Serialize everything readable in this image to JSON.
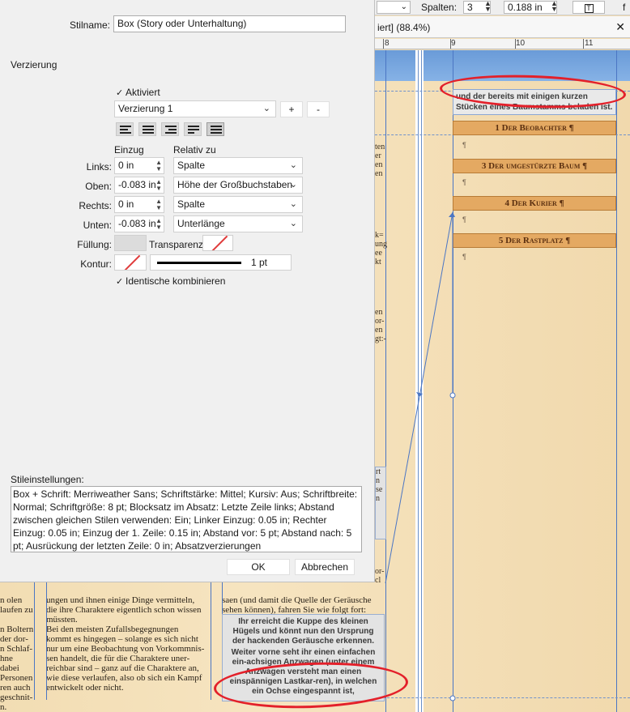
{
  "toolbar": {
    "columns_label": "Spalten:",
    "columns_value": "3",
    "gutter_value": "0.188 in"
  },
  "document": {
    "tab_title": "iert] (88.4%)",
    "ruler_numbers": [
      "8",
      "9",
      "10",
      "11"
    ],
    "top_box_text": "und der bereits mit einigen kurzen Stücken eines Baumstamms beladen ist.",
    "headings": [
      {
        "num": "1",
        "label": "Der Beobachter"
      },
      {
        "num": "3",
        "label": "Der umgestürzte Baum"
      },
      {
        "num": "4",
        "label": "Der Kurier"
      },
      {
        "num": "5",
        "label": "Der Rastplatz"
      }
    ],
    "left_col1": [
      "n olen",
      "laufen zu",
      "",
      "n Boltern",
      "der dor-",
      "n Schlaf-",
      "hne dabei",
      "Personen",
      "ren auch",
      "geschnit-",
      "n."
    ],
    "left_col2": [
      "ungen und ihnen einige Dinge vermitteln,",
      "die ihre Charaktere eigentlich schon wissen",
      "müssten.",
      "   Bei den meisten Zufallsbegegnungen",
      "kommt es hingegen – solange es sich nicht",
      "nur um eine Beobachtung von Vorkommnis-",
      "sen handelt, die für die Charaktere uner-",
      "reichbar sind – ganz auf die Charaktere an,",
      "wie diese verlaufen, also ob sich ein Kampf",
      "entwickelt oder nicht."
    ],
    "mid_col_top": [
      "saen (und damit die Quelle der Geräusche",
      "sehen können), fahren Sie wie folgt fort:"
    ],
    "bottom_box_p1": "Ihr erreicht die Kuppe des kleinen Hügels und könnt nun den Ursprung der hackenden Geräusche erkennen.",
    "bottom_box_p2": "Weiter vorne seht ihr einen einfachen ein-achsigen Anzwagen (unter einem Anzwagen versteht man einen einspännigen Lastkar-ren), in welchen ein Ochse eingespannt ist,",
    "edge_fragments": [
      "ten",
      "er",
      "en",
      "en",
      "k=",
      "ung",
      "ee",
      "kt",
      "en",
      "or-",
      "en",
      "gt:-",
      "rt",
      "n",
      "se",
      "n",
      "or-",
      "cl"
    ]
  },
  "dialog": {
    "style_name_label": "Stilname:",
    "style_name_value": "Box (Story oder Unterhaltung)",
    "section_label": "Verzierung",
    "enabled_label": "Aktiviert",
    "decoration_select": "Verzierung 1",
    "plus_label": "+",
    "minus_label": "-",
    "indent_header": "Einzug",
    "relative_header": "Relativ zu",
    "rows": [
      {
        "label": "Links:",
        "value": "0 in",
        "relative": "Spalte"
      },
      {
        "label": "Oben:",
        "value": "-0.083 in",
        "relative": "Höhe der Großbuchstaben"
      },
      {
        "label": "Rechts:",
        "value": "0 in",
        "relative": "Spalte"
      },
      {
        "label": "Unten:",
        "value": "-0.083 in",
        "relative": "Unterlänge"
      }
    ],
    "fill_label": "Füllung:",
    "transparency_label": "Transparenz:",
    "stroke_label": "Kontur:",
    "stroke_width": "1 pt",
    "combine_label": "Identische kombinieren",
    "style_settings_label": "Stileinstellungen:",
    "style_settings_text": "Box + Schrift: Merriweather Sans; Schriftstärke: Mittel; Kursiv: Aus; Schriftbreite: Normal; Schriftgröße: 8 pt; Blocksatz im Absatz: Letzte Zeile links; Abstand zwischen gleichen Stilen verwenden: Ein; Linker Einzug: 0.05 in; Rechter Einzug: 0.05 in; Einzug der 1. Zeile: 0.15 in; Abstand vor: 5 pt; Abstand nach: 5 pt; Ausrückung der letzten Zeile: 0 in; Absatzverzierungen",
    "ok_label": "OK",
    "cancel_label": "Abbrechen"
  },
  "colors": {
    "annotation_red": "#e3202a",
    "heading_fill": "#e4a962",
    "guide_blue": "#4b76c4"
  }
}
